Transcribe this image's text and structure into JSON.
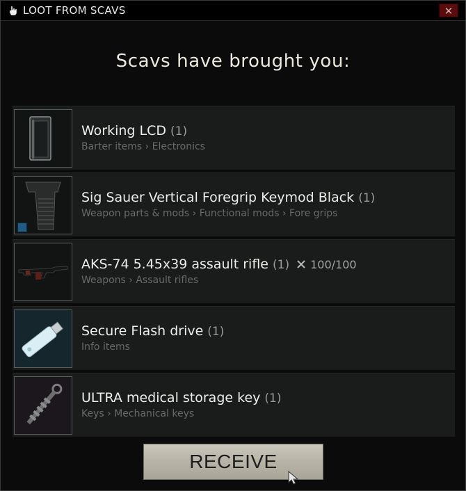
{
  "window": {
    "title": "LOOT FROM SCAVS",
    "close_label": "✕",
    "heading": "Scavs have brought you:"
  },
  "items": [
    {
      "name": "Working LCD",
      "qty": "(1)",
      "category": "Barter items › Electronics",
      "icon": "lcd-screen-icon"
    },
    {
      "name": "Sig Sauer Vertical Foregrip Keymod Black",
      "qty": "(1)",
      "category": "Weapon parts & mods › Functional mods › Fore grips",
      "icon": "foregrip-icon"
    },
    {
      "name": "AKS-74 5.45x39 assault rifle",
      "qty": "(1)",
      "category": "Weapons › Assault rifles",
      "durability": "100/100",
      "icon": "assault-rifle-icon"
    },
    {
      "name": "Secure Flash drive",
      "qty": "(1)",
      "category": "Info items",
      "icon": "flash-drive-icon"
    },
    {
      "name": "ULTRA medical storage key",
      "qty": "(1)",
      "category": "Keys › Mechanical keys",
      "icon": "mechanical-key-icon"
    }
  ],
  "receive_label": "RECEIVE",
  "colors": {
    "title_bar": "#000000",
    "close_button": "#5a0c0c",
    "row_background": "#1a1b1b",
    "receive_button": "#b7b3a6"
  }
}
